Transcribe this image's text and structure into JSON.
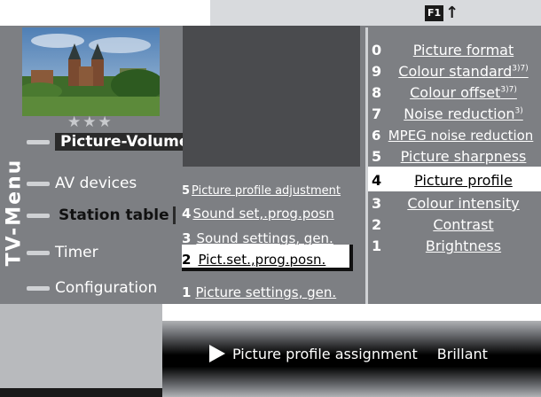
{
  "topbar": {
    "f1_label": "F1",
    "f1_arrow": "↑"
  },
  "photo": {
    "stars": "★★★"
  },
  "side_title": "TV-Menu",
  "left_menu": [
    {
      "label": "Picture-Volume"
    },
    {
      "label": "AV devices"
    },
    {
      "label": "Station table"
    },
    {
      "label": "Timer"
    },
    {
      "label": "Configuration"
    }
  ],
  "middle_menu": [
    {
      "num": "5",
      "label": "Picture profile adjustment"
    },
    {
      "num": "4",
      "label": "Sound set,.prog.posn"
    },
    {
      "num": "3",
      "label": "Sound settings, gen."
    },
    {
      "num": "2",
      "label": "Pict.set.,prog.posn."
    },
    {
      "num": "1",
      "label": "Picture settings, gen."
    }
  ],
  "right_menu": [
    {
      "num": "0",
      "label": "Picture format",
      "sup": ""
    },
    {
      "num": "9",
      "label": "Colour  standard",
      "sup": "3)7)"
    },
    {
      "num": "8",
      "label": "Colour offset",
      "sup": "3)7)"
    },
    {
      "num": "7",
      "label": "Noise reduction",
      "sup": "3)"
    },
    {
      "num": "6",
      "label": "MPEG noise reduction",
      "sup": ""
    },
    {
      "num": "5",
      "label": "Picture sharpness",
      "sup": ""
    },
    {
      "num": "4",
      "label": "Picture  profile",
      "sup": ""
    },
    {
      "num": "3",
      "label": "Colour intensity",
      "sup": ""
    },
    {
      "num": "2",
      "label": "Contrast",
      "sup": ""
    },
    {
      "num": "1",
      "label": "Brightness",
      "sup": ""
    }
  ],
  "banner": {
    "label": "Picture profile assignment",
    "value": "Brillant"
  },
  "colors": {
    "panel": "#7d7f83",
    "highlight": "#ffffff",
    "banner": "#000000"
  }
}
